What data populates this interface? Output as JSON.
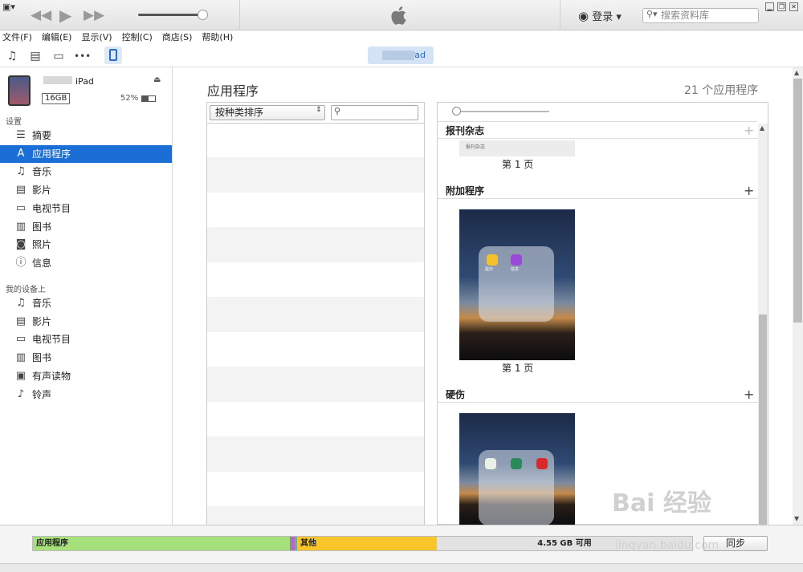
{
  "titlebar": {
    "menu_toggle": "▣▾",
    "login": "登录 ▾",
    "search_placeholder": "搜索资料库",
    "win_buttons": [
      "▁",
      "❐",
      "✕"
    ]
  },
  "menubar": [
    "文件(F)",
    "编辑(E)",
    "显示(V)",
    "控制(C)",
    "商店(S)",
    "帮助(H)"
  ],
  "toolbar": {
    "device_pill": "iPad"
  },
  "device": {
    "name": "iPad",
    "capacity": "16GB",
    "battery": "52%"
  },
  "sidebar": {
    "settings_label": "设置",
    "settings_items": [
      {
        "label": "摘要",
        "icon": "summary-icon",
        "glyph": "☰"
      },
      {
        "label": "应用程序",
        "icon": "apps-icon",
        "glyph": "A"
      },
      {
        "label": "音乐",
        "icon": "music-icon",
        "glyph": "♫"
      },
      {
        "label": "影片",
        "icon": "film-icon",
        "glyph": "▤"
      },
      {
        "label": "电视节目",
        "icon": "tv-icon",
        "glyph": "▭"
      },
      {
        "label": "图书",
        "icon": "book-icon",
        "glyph": "▥"
      },
      {
        "label": "照片",
        "icon": "camera-icon",
        "glyph": "◙"
      },
      {
        "label": "信息",
        "icon": "info-icon",
        "glyph": "ⓘ"
      }
    ],
    "ondevice_label": "我的设备上",
    "ondevice_items": [
      {
        "label": "音乐",
        "icon": "music-icon",
        "glyph": "♫"
      },
      {
        "label": "影片",
        "icon": "film-icon",
        "glyph": "▤"
      },
      {
        "label": "电视节目",
        "icon": "tv-icon",
        "glyph": "▭"
      },
      {
        "label": "图书",
        "icon": "book-icon",
        "glyph": "▥"
      },
      {
        "label": "有声读物",
        "icon": "audiobook-icon",
        "glyph": "▣"
      },
      {
        "label": "铃声",
        "icon": "bell-icon",
        "glyph": "♪"
      }
    ]
  },
  "main": {
    "title": "应用程序",
    "app_count": "21 个应用程序",
    "sort_label": "按种类排序",
    "sections": [
      {
        "title": "报刊杂志",
        "page": "第 1 页",
        "thumb_text": "报刊杂志"
      },
      {
        "title": "附加程序",
        "page": "第 1 页",
        "app_labels": [
          "提示",
          "信息"
        ]
      },
      {
        "title": "硬伤"
      }
    ]
  },
  "capacity_bar": {
    "apps_label": "应用程序",
    "other_label": "其他",
    "free_label": "4.55 GB 可用",
    "colors": {
      "apps": "#a6e07b",
      "music": "#b06fc0",
      "other": "#f8c52a",
      "free": "#e2e2e2"
    }
  },
  "sync_button": "同步",
  "watermark": {
    "main": "Bai 经验",
    "sub": "jingyan.baidu.com"
  }
}
